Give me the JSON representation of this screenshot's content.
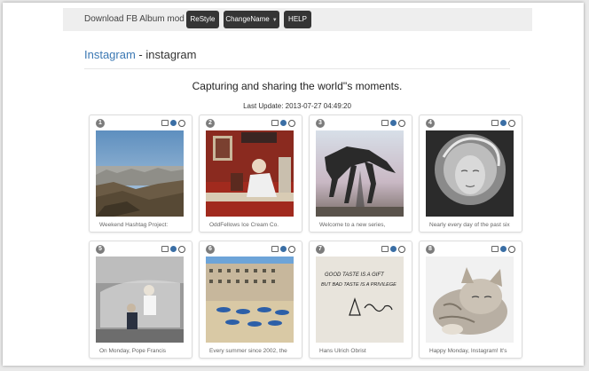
{
  "topbar": {
    "brand": "Download FB Album mod",
    "buttons": [
      {
        "label": "ReStyle"
      },
      {
        "label": "ChangeName"
      },
      {
        "label": "HELP"
      }
    ]
  },
  "header": {
    "link_text": "Instagram",
    "separator": " - ",
    "account": "instagram"
  },
  "tagline": "Capturing and sharing the world''s moments.",
  "last_update": "Last Update: 2013-07-27 04:49:20",
  "cards": [
    {
      "number": "1",
      "caption": "Weekend Hashtag Project:"
    },
    {
      "number": "2",
      "caption": "OddFellows Ice Cream Co."
    },
    {
      "number": "3",
      "caption": "Welcome to a new series,"
    },
    {
      "number": "4",
      "caption": "Nearly every day of the past six"
    },
    {
      "number": "5",
      "caption": "On Monday, Pope Francis"
    },
    {
      "number": "6",
      "caption": "Every summer since 2002, the"
    },
    {
      "number": "7",
      "caption": "Hans Ulrich Obrist"
    },
    {
      "number": "8",
      "caption": "Happy Monday, Instagram! It's"
    }
  ],
  "photo7_text": [
    "GOOD TASTE IS A GIFT",
    "BUT BAD TASTE IS A PRIVILEGE"
  ],
  "colors": {
    "link": "#3b78b3",
    "button_bg": "#353535",
    "topbar_bg": "#eeeeee",
    "badge_bg": "#7c7c7c"
  }
}
